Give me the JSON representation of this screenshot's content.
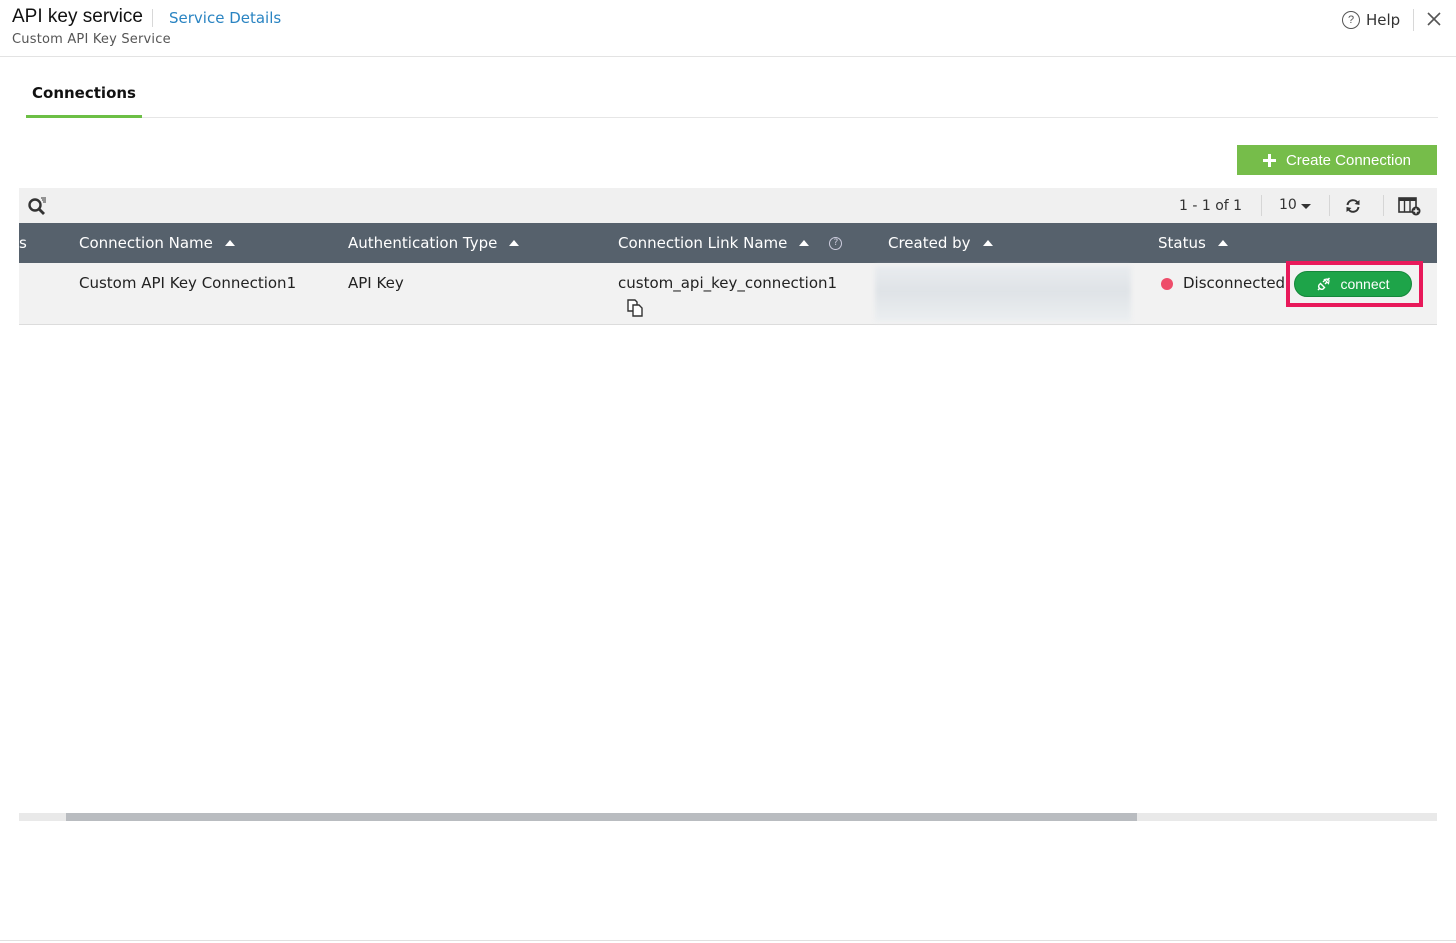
{
  "header": {
    "title": "API key service",
    "service_details_link": "Service Details",
    "subtitle": "Custom API Key Service",
    "help_label": "Help",
    "help_icon": "question-circle-icon",
    "close_icon": "close-icon"
  },
  "tabs": [
    {
      "label": "Connections",
      "active": true
    }
  ],
  "actions": {
    "create_connection_label": "Create Connection",
    "create_icon": "plus-icon"
  },
  "toolbar": {
    "search_icon": "search-filter-icon",
    "pagination": "1 - 1 of 1",
    "page_size": "10",
    "refresh_icon": "refresh-icon",
    "columns_icon": "column-settings-icon"
  },
  "table": {
    "partial_column_label": "s",
    "columns": [
      {
        "label": "Connection Name",
        "sort": "asc"
      },
      {
        "label": "Authentication Type",
        "sort": "asc"
      },
      {
        "label": "Connection Link Name",
        "sort": "asc",
        "has_help": true
      },
      {
        "label": "Created by",
        "sort": "asc"
      },
      {
        "label": "Status",
        "sort": "asc"
      }
    ],
    "rows": [
      {
        "connection_name": "Custom API Key Connection1",
        "auth_type": "API Key",
        "link_name": "custom_api_key_connection1",
        "created_by": "",
        "status": "Disconnected",
        "status_color": "#ee4d6a",
        "action_label": "connect"
      }
    ]
  },
  "colors": {
    "accent_green": "#76bd4a",
    "connect_green": "#1ea449",
    "header_bg": "#56616c",
    "link_blue": "#2a84c2",
    "highlight": "#e8195a"
  }
}
